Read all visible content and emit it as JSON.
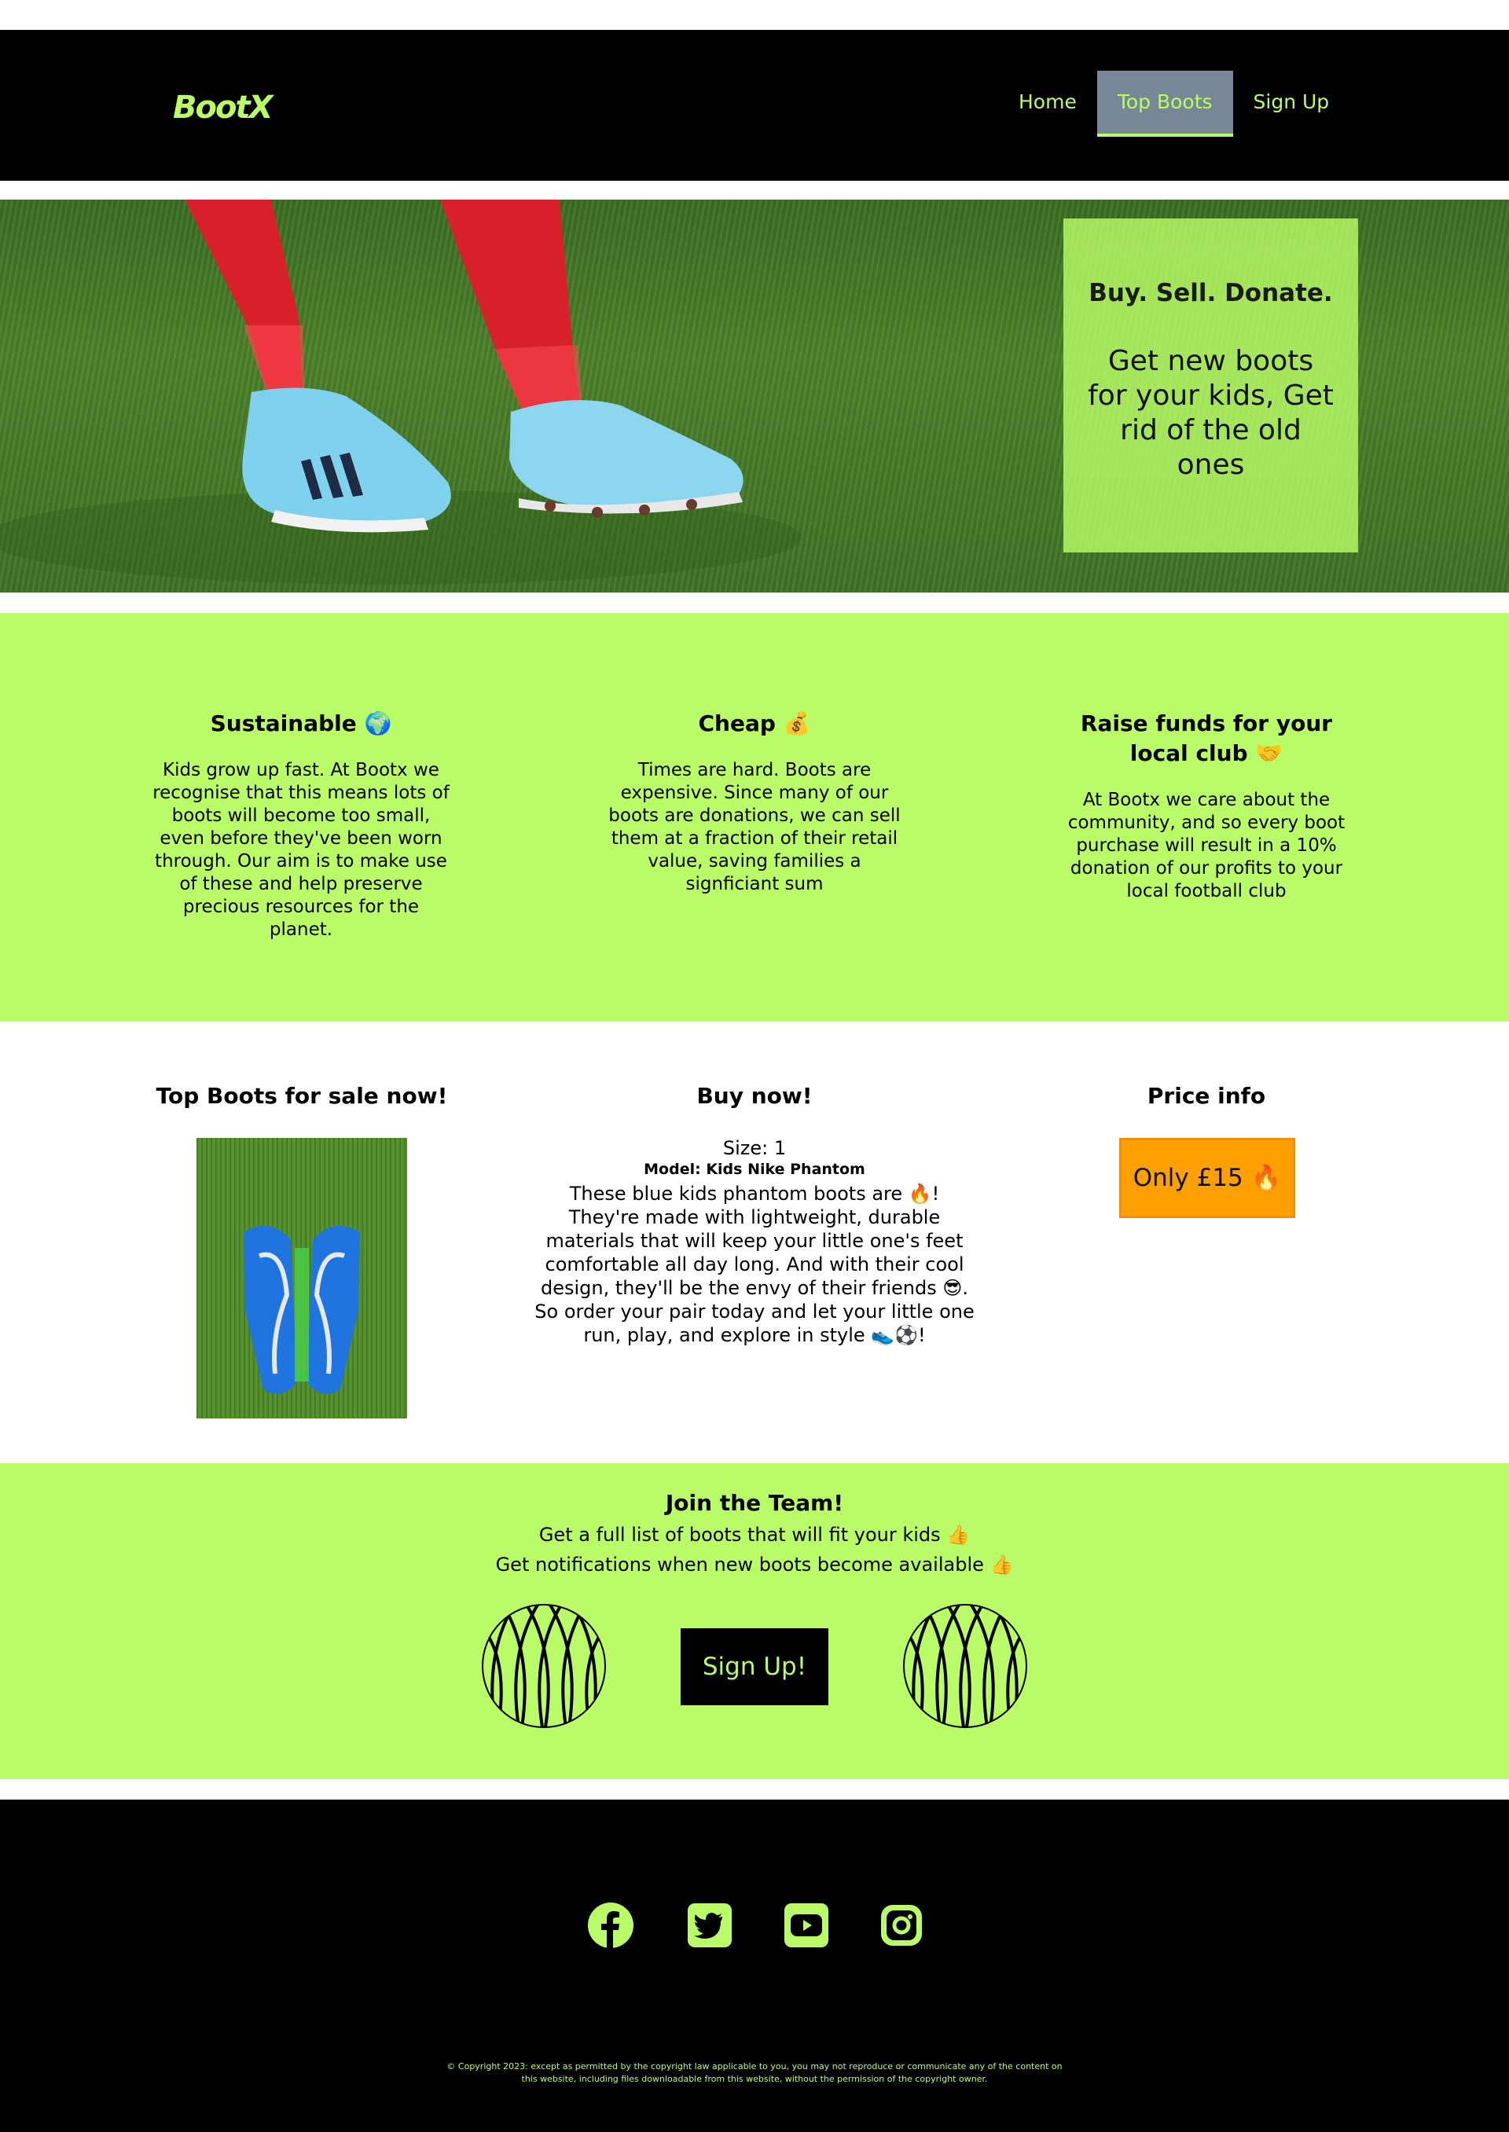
{
  "brand": {
    "logo_text": "BootX",
    "accent_color": "#b9fc67",
    "nav_active_color": "#778797"
  },
  "nav": {
    "items": [
      {
        "label": "Home",
        "active": false
      },
      {
        "label": "Top Boots",
        "active": true
      },
      {
        "label": "Sign Up",
        "active": false
      }
    ]
  },
  "hero": {
    "title": "Buy. Sell. Donate.",
    "subtitle": "Get new boots for your kids, Get rid of the old ones"
  },
  "features": [
    {
      "title": "Sustainable 🌍",
      "text": "Kids grow up fast. At Bootx we recognise that this means lots of boots will become too small, even before they've been worn through. Our aim is to make use of these and help preserve precious resources for the planet."
    },
    {
      "title": "Cheap 💰",
      "text": "Times are hard. Boots are expensive. Since many of our boots are donations, we can sell them at a fraction of their retail value, saving families a signficiant sum"
    },
    {
      "title": "Raise funds for your local club 🤝",
      "text": "At Bootx we care about the community, and so every boot purchase will result in a 10% donation of our profits to your local football club"
    }
  ],
  "product": {
    "top_boots_title": "Top Boots for sale now!",
    "buy_title": "Buy now!",
    "price_title": "Price info",
    "size": "Size: 1",
    "model": "Model: Kids Nike Phantom",
    "description": "These blue kids phantom boots are 🔥! They're made with lightweight, durable materials that will keep your little one's feet comfortable all day long. And with their cool design, they'll be the envy of their friends 😎. So order your pair today and let your little one run, play, and explore in style 👟⚽!",
    "price_label": "Only £15 🔥"
  },
  "join": {
    "title": "Join the Team!",
    "line1": "Get a full list of boots that will fit your kids 👍",
    "line2": "Get notifications when new boots become available 👍",
    "button_label": "Sign Up!"
  },
  "footer": {
    "social_icons": [
      "facebook-icon",
      "twitter-icon",
      "youtube-icon",
      "instagram-icon"
    ],
    "copyright": "© Copyright 2023: except as permitted by the copyright law applicable to you, you may not reproduce or communicate any of the content on this website, including files downloadable from this website, without the permission of the copyright owner."
  }
}
